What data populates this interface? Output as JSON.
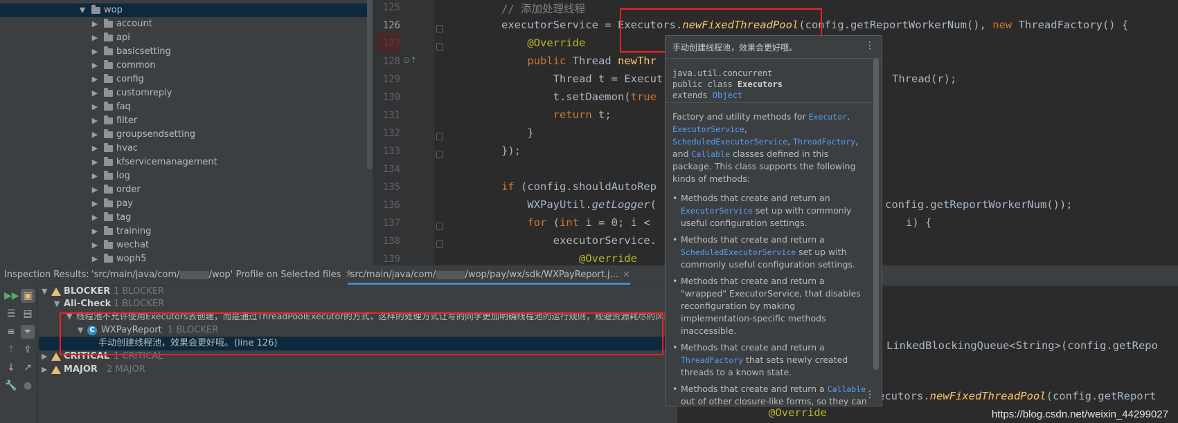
{
  "colors": {
    "highlight_box": "#ff1f1f",
    "selection": "#0d293e",
    "keyword": "#cc7832",
    "annotation": "#bbb529",
    "function": "#ffc66d",
    "link": "#589df6"
  },
  "tree": {
    "root": "wop",
    "folders": [
      "account",
      "api",
      "basicsetting",
      "common",
      "config",
      "customreply",
      "faq",
      "filter",
      "groupsendsetting",
      "hvac",
      "kfservicemanagement",
      "log",
      "order",
      "pay",
      "tag",
      "training",
      "wechat",
      "woph5"
    ]
  },
  "editor": {
    "lines": [
      {
        "n": "125",
        "parts": [
          [
            "cm",
            "// 添加处理线程"
          ]
        ]
      },
      {
        "n": "126",
        "parts": [
          [
            "pl",
            "executorService = "
          ],
          [
            "pl",
            "Executors."
          ],
          [
            "fni",
            "newFixedThreadPool"
          ],
          [
            "pl",
            "(config.getReportWorkerNum(), "
          ],
          [
            "kw",
            "new "
          ],
          [
            "pl",
            "ThreadFactory() {"
          ]
        ]
      },
      {
        "n": "127",
        "parts": [
          [
            "an",
            "    @Override"
          ]
        ]
      },
      {
        "n": "128",
        "parts": [
          [
            "kw",
            "    public "
          ],
          [
            "pl",
            "Thread "
          ],
          [
            "fn",
            "newThr"
          ]
        ]
      },
      {
        "n": "129",
        "parts": [
          [
            "pl",
            "        Thread t = Execut"
          ]
        ]
      },
      {
        "n": "130",
        "parts": [
          [
            "pl",
            "        t.setDaemon("
          ],
          [
            "kw",
            "true"
          ]
        ]
      },
      {
        "n": "131",
        "parts": [
          [
            "kw",
            "        return "
          ],
          [
            "pl",
            "t;"
          ]
        ]
      },
      {
        "n": "132",
        "parts": [
          [
            "pl",
            "    }"
          ]
        ]
      },
      {
        "n": "133",
        "parts": [
          [
            "pl",
            "});"
          ]
        ]
      },
      {
        "n": "134",
        "parts": [
          [
            "pl",
            ""
          ]
        ]
      },
      {
        "n": "135",
        "parts": [
          [
            "kw",
            "if "
          ],
          [
            "pl",
            "(config.shouldAutoRep"
          ]
        ]
      },
      {
        "n": "136",
        "parts": [
          [
            "pl",
            "    WXPayUtil."
          ],
          [
            "it",
            "getLogger"
          ],
          [
            "pl",
            "("
          ]
        ]
      },
      {
        "n": "137",
        "parts": [
          [
            "kw",
            "    for "
          ],
          [
            "pl",
            "("
          ],
          [
            "kw",
            "int "
          ],
          [
            "pl",
            "i = "
          ],
          [
            "pl",
            "0"
          ],
          [
            "pl",
            "; i <"
          ]
        ]
      },
      {
        "n": "138",
        "parts": [
          [
            "pl",
            "        executorService."
          ]
        ]
      },
      {
        "n": "139",
        "parts": [
          [
            "an",
            "            @Override"
          ]
        ]
      }
    ],
    "right_fragments": {
      "line129": "Thread(r);",
      "line136": "config.getReportWorkerNum());",
      "line137": "i) {"
    }
  },
  "bottom_code": {
    "line_a": ";",
    "line_b": "LinkedBlockingQueue<String>(config.getRepo",
    "line_c_prefix": "ecutors.",
    "line_c_fn": "newFixedThreadPool",
    "line_c_suffix": "(config.getReport",
    "line_d": "@Override"
  },
  "inspection": {
    "label": "Inspection Results:",
    "tab1_a": "'src/main/java/com/",
    "tab1_b": "/wop' Profile on Selected files",
    "tab2_a": "'src/main/java/com/",
    "tab2_b": "/wop/pay/wx/sdk/WXPayReport.j...",
    "close": "×",
    "rows": {
      "blocker": "BLOCKER",
      "blocker_count": "1 BLOCKER",
      "alicheck": "Ali-Check",
      "alicheck_count": "1 BLOCKER",
      "rule": "线程池不允许使用Executors去创建，而是通过ThreadPoolExecutor的方式，这样的处理方式让写的同学更加明确线程池的运行规则，规避资源耗尽的风险。",
      "class_name": "WXPayReport",
      "class_count": "1 BLOCKER",
      "class_icon": "C",
      "problem": "手动创建线程池，效果会更好哦。",
      "problem_line": "(line 126)",
      "critical": "CRITICAL",
      "critical_count": "1 CRITICAL",
      "major": "MAJOR",
      "major_count": "2 MAJOR"
    }
  },
  "popup": {
    "header": "手动创建线程池，效果会更好哦。",
    "menu_icon": "⋮",
    "decl_pkg": "java.util.concurrent",
    "decl_cls_prefix": "public class ",
    "decl_cls_name": "Executors",
    "decl_ext_prefix": "extends ",
    "decl_ext": "Object",
    "desc_1": "Factory and utility methods for ",
    "link_executor": "Executor",
    "link_executorservice": "ExecutorService",
    "link_scheduled": "ScheduledExecutorService",
    "link_threadfactory": "ThreadFactory",
    "desc_and": "and ",
    "link_callable": "Callable",
    "desc_2": " classes defined in this package. This class supports the following kinds of methods:",
    "b1_a": "Methods that create and return an ",
    "b1_link": "ExecutorService",
    "b1_b": " set up with commonly useful configuration settings.",
    "b2_a": "Methods that create and return a ",
    "b2_link": "ScheduledExecutorService",
    "b2_b": " set up with commonly useful configuration settings.",
    "b3": "Methods that create and return a \"wrapped\" ExecutorService, that disables reconfiguration by making implementation-specific methods inaccessible.",
    "b4_a": "Methods that create and return a ",
    "b4_link": "ThreadFactory",
    "b4_b": " that sets newly created threads to a known state.",
    "b5_a": "Methods that create and return a ",
    "b5_link": "Callable",
    "b5_b": " out of other closure-like forms, so they can be used in execution"
  },
  "watermark": "https://blog.csdn.net/weixin_44299027"
}
